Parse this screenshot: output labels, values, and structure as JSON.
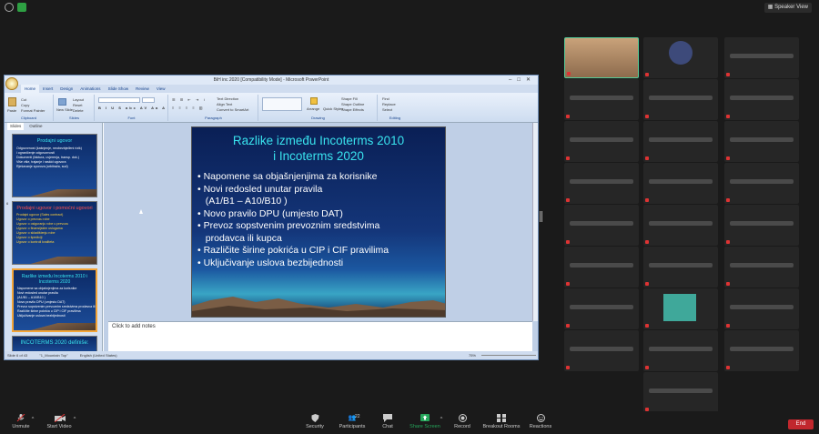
{
  "zoom_top": {
    "speaker_view": "Speaker View"
  },
  "ppt": {
    "title": "BiH inc 2020 [Compatibility Mode] - Microsoft PowerPoint",
    "tabs": [
      "Home",
      "Insert",
      "Design",
      "Animations",
      "Slide Show",
      "Review",
      "View"
    ],
    "ribbon": {
      "paste": "Paste",
      "cut": "Cut",
      "copy": "Copy",
      "format_painter": "Format Painter",
      "clipboard": "Clipboard",
      "new_slide": "New Slide",
      "layout": "Layout",
      "reset": "Reset",
      "delete": "Delete",
      "slides": "Slides",
      "font": "Font",
      "paragraph": "Paragraph",
      "text_direction": "Text Direction",
      "align_text": "Align Text",
      "convert_smartart": "Convert to SmartArt",
      "arrange": "Arrange",
      "quick_styles": "Quick Styles",
      "shape_fill": "Shape Fill",
      "shape_outline": "Shape Outline",
      "shape_effects": "Shape Effects",
      "drawing": "Drawing",
      "find": "Find",
      "replace": "Replace",
      "select": "Select",
      "editing": "Editing"
    },
    "panel_tabs": [
      "Slides",
      "Outline"
    ],
    "thumbs": [
      {
        "num": "",
        "title": "Prodajni ugovor",
        "lines": [
          "Odgovornost (kašnjenje, neobezbjeđeni rizik)",
          "i ograničenje odgovornosti",
          "",
          "Dokumenti (faktura, uvjerenja, transp. dok.)",
          "",
          "Više više, trajanje i raskid ugovora",
          "",
          "Rješavanje sporova (arbitraža, sud)"
        ]
      },
      {
        "num": "6",
        "title": "Prodajni ugovor i pomoćni ugovori",
        "lines": [
          "Prodajni ugovor (Sales contract)",
          "Ugovor o prevozu robe",
          "Ugovor o osiguranju robe u prevozu",
          "Ugovor o finansijskim uslugama",
          "Ugovor o skladištenju robe",
          "Ugovor o špediciji",
          "Ugovor o kontroli kvaliteta"
        ]
      },
      {
        "num": "",
        "title": "Razlike između Incoterms 2010 i Incoterms 2020",
        "lines": [
          "Napomene sa objašnjenjima za korisnike",
          "Novi redosled unutar pravila",
          "(A1/B1 – A10/B10 )",
          "Novo pravilo DPU (umjesto DAT)",
          "Prevoz sopstvenim prevoznim sredstvima prodavca ili kupca",
          "Različite širine pokrića u CIP i CIF pravilima",
          "Uključivanje uslova bezbijednosti"
        ]
      },
      {
        "num": "",
        "title": "INCOTERMS 2020 definiše:",
        "lines": []
      }
    ],
    "slide": {
      "title_line1": "Razlike između Incoterms 2010",
      "title_line2": "i Incoterms 2020",
      "bullets": [
        "Napomene sa objašnjenjima za korisnike",
        "Novi redosled unutar pravila",
        "(A1/B1 – A10/B10 )",
        "Novo pravilo DPU (umjesto DAT)",
        "Prevoz sopstvenim prevoznim sredstvima",
        "prodavca ili kupca",
        "Različite širine pokrića u CIP i CIF pravilima",
        "Uključivanje uslova bezbijednosti"
      ],
      "bullet_flags": [
        true,
        true,
        false,
        true,
        true,
        false,
        true,
        true
      ]
    },
    "notes_placeholder": "Click to add notes",
    "status": {
      "slide": "Slide 6 of 43",
      "theme": "\"1_Mountain Top\"",
      "lang": "English (United States)",
      "zoom": "75%"
    }
  },
  "toolbar": {
    "unmute": "Unmute",
    "start_video": "Start Video",
    "security": "Security",
    "participants": "Participants",
    "participants_count": "22",
    "chat": "Chat",
    "share_screen": "Share Screen",
    "record": "Record",
    "breakout_rooms": "Breakout Rooms",
    "reactions": "Reactions",
    "end": "End"
  },
  "colors": {
    "zoom_bg": "#1a1a1a",
    "share_green": "#26a65b",
    "end_red": "#c1272d",
    "slide_title_cyan": "#39e3ee"
  }
}
